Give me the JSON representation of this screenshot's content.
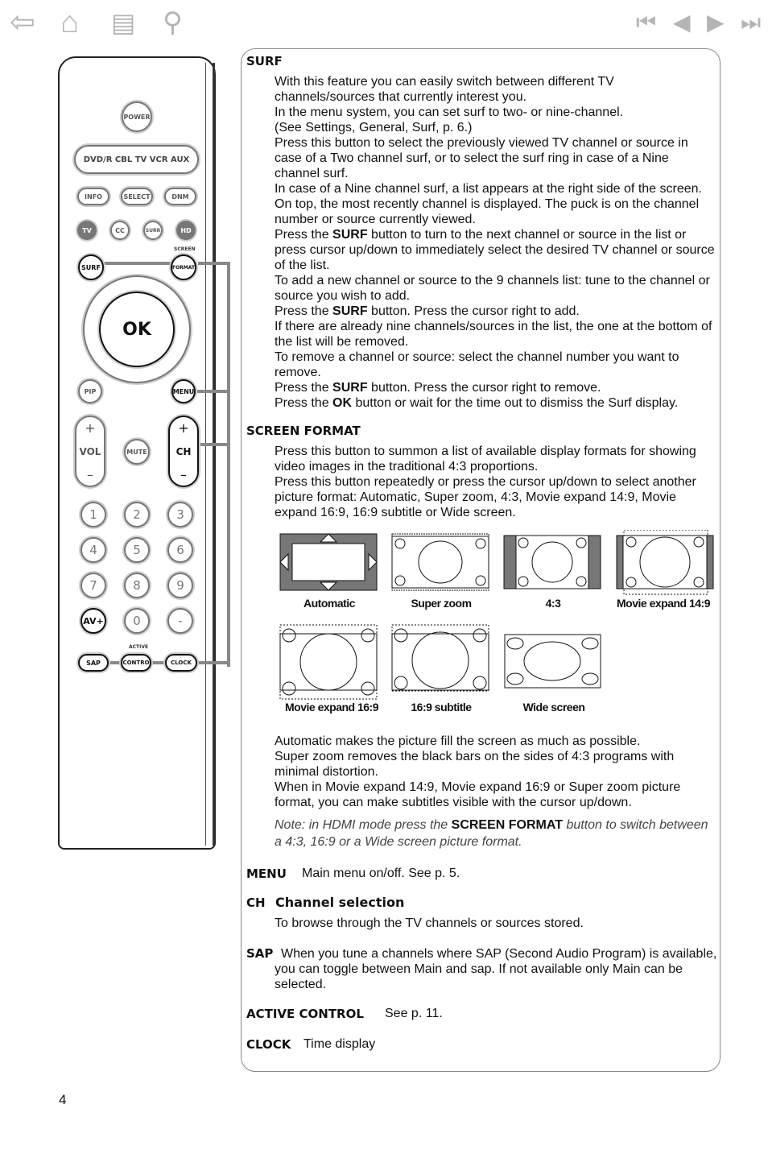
{
  "toolbar": {
    "icons": [
      "back-arrow-icon",
      "home-icon",
      "print-icon",
      "search-icon"
    ],
    "nav_icons": [
      "first-page-icon",
      "previous-page-icon",
      "next-page-icon",
      "last-page-icon"
    ]
  },
  "remote": {
    "power": "POWER",
    "sources": "DVD/R  CBL  TV  VCR  AUX",
    "info": "INFO",
    "select": "SELECT",
    "dnm": "DNM",
    "tv": "TV",
    "cc": "CC",
    "surr": "SURR",
    "hd": "HD",
    "screen": "SCREEN",
    "surf": "SURF",
    "format": "FORMAT",
    "ok": "OK",
    "pip": "PIP",
    "menu": "MENU",
    "vol": "VOL",
    "mute": "MUTE",
    "ch": "CH",
    "plus": "+",
    "minus": "–",
    "digits": [
      "1",
      "2",
      "3",
      "4",
      "5",
      "6",
      "7",
      "8",
      "9",
      "AV+",
      "0",
      "-"
    ],
    "active": "ACTIVE",
    "sap": "SAP",
    "contro": "CONTRO",
    "clock": "CLOCK"
  },
  "surf": {
    "heading": "SURF",
    "paras": [
      "With this feature you can easily switch between different TV channels/sources that currently interest you.",
      "In the menu system, you can set surf to two- or nine-channel.",
      "(See Settings, General, Surf,  p. 6.)",
      "Press this button to select the previously viewed TV channel or source in case of a Two channel surf, or to select the surf ring in case of a Nine channel surf.",
      "In case of a Nine channel surf, a list appears at the right side of the screen. On top, the most recently channel is displayed.  The puck is on the channel number or source currently viewed."
    ],
    "p_a1": "Press the ",
    "p_ab": "SURF",
    "p_a2": " button to turn to the next channel or source in the list or press cursor up/down to immediately select the desired TV channel or source of the list.",
    "p_b": "To add a new channel or source to the 9 channels list: tune to the channel or source you wish to add.",
    "p_c1": "Press the ",
    "p_cb": "SURF",
    "p_c2": " button. Press the cursor right to add.",
    "p_d": "If there are already nine channels/sources in the list, the one at the bottom of the list will be removed.",
    "p_e": "To remove a channel or source: select the channel number you want to remove.",
    "p_f1": "Press the ",
    "p_fb": "SURF",
    "p_f2": " button. Press the cursor right to remove.",
    "p_g1": "Press the ",
    "p_gb": "OK",
    "p_g2": " button or wait for the time out to dismiss the Surf display."
  },
  "screen_format": {
    "heading": "SCREEN FORMAT",
    "p1": "Press this button to summon a list of available display formats for showing video images in the traditional 4:3 proportions.",
    "p2": "Press this button repeatedly or press the cursor up/down to select another picture format: Automatic, Super zoom, 4:3, Movie expand 14:9, Movie expand 16:9, 16:9 subtitle or Wide screen.",
    "formats": [
      "Automatic",
      "Super zoom",
      "4:3",
      "Movie expand 14:9",
      "Movie expand 16:9",
      "16:9 subtitle",
      "Wide screen"
    ],
    "p3": "Automatic makes the picture fill the screen as much as possible.",
    "p4": "Super zoom removes the black bars on the sides of 4:3 programs with minimal distortion.",
    "p5": "When in Movie expand 14:9, Movie expand 16:9 or Super zoom picture format, you can make subtitles visible with the cursor up/down.",
    "note1": "Note: in HDMI mode press the ",
    "note_b": "SCREEN FORMAT",
    "note2": " button to switch between a 4:3, 16:9 or a Wide screen picture format."
  },
  "menu": {
    "heading": "MENU",
    "text": "Main menu on/off. See p. 5."
  },
  "ch": {
    "heading": "CH",
    "title": "Channel selection",
    "text": "To browse through the TV channels or sources stored."
  },
  "sap": {
    "heading": "SAP",
    "text": "When you tune a channels where SAP (Second Audio Program) is available, you can toggle between Main and sap. If not available only Main can be selected."
  },
  "active": {
    "heading": "ACTIVE CONTROL",
    "text": "See p. 11."
  },
  "clock": {
    "heading": "CLOCK",
    "text": "Time display"
  },
  "page_number": "4"
}
